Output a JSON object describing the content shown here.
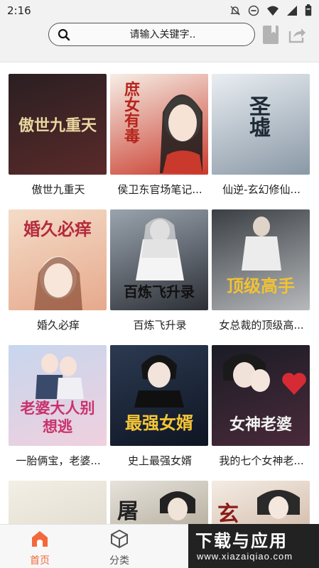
{
  "status_bar": {
    "time": "2:16"
  },
  "search": {
    "placeholder": "请输入关键字.."
  },
  "books": [
    {
      "title": "傲世九重天",
      "cover_text": "傲世九重天",
      "colors": [
        "#2a1f22",
        "#5a2a2a"
      ],
      "text_color": "#e9d5a0"
    },
    {
      "title": "侯卫东官场笔记...",
      "cover_text": "庶女有毒",
      "colors": [
        "#f6efe6",
        "#c93a2c"
      ],
      "text_color": "#b4241c"
    },
    {
      "title": "仙逆-玄幻修仙...",
      "cover_text": "圣墟",
      "colors": [
        "#e9eef2",
        "#8a98a6"
      ],
      "text_color": "#1e2a36"
    },
    {
      "title": "婚久必痒",
      "cover_text": "婚久必痒",
      "colors": [
        "#f4dcc8",
        "#e6a98c"
      ],
      "text_color": "#b42a3c"
    },
    {
      "title": "百炼飞升录",
      "cover_text": "百炼飞升录",
      "colors": [
        "#9aa4ae",
        "#2c2f36"
      ],
      "text_color": "#111111"
    },
    {
      "title": "女总裁的顶级高...",
      "cover_text": "顶级高手",
      "colors": [
        "#3a3f44",
        "#b7b9bb"
      ],
      "text_color": "#f2c233"
    },
    {
      "title": "一胎俩宝，老婆...",
      "cover_text": "老婆大人别想逃",
      "colors": [
        "#c7d6ee",
        "#f0d0de"
      ],
      "text_color": "#c8326b"
    },
    {
      "title": "史上最强女婿",
      "cover_text": "最强女婿",
      "colors": [
        "#2c3a52",
        "#0e1522"
      ],
      "text_color": "#f5c637"
    },
    {
      "title": "我的七个女神老...",
      "cover_text": "女神老婆",
      "colors": [
        "#1a1c26",
        "#4a2a3a"
      ],
      "text_color": "#f2f2f2"
    },
    {
      "title": "",
      "cover_text": "",
      "colors": [
        "#f2efe6",
        "#d9d2c2"
      ],
      "text_color": "#333333"
    },
    {
      "title": "",
      "cover_text": "屠",
      "colors": [
        "#e6e3dc",
        "#9a8f7a"
      ],
      "text_color": "#222222"
    },
    {
      "title": "",
      "cover_text": "玄",
      "colors": [
        "#f4ece4",
        "#c2a38c"
      ],
      "text_color": "#8a1c18"
    }
  ],
  "nav": {
    "home": "首页",
    "category": "分类"
  },
  "watermark": {
    "main": "下载与应用",
    "sub": "www.xiazaiqiao.com"
  },
  "colors": {
    "accent": "#f26a3c",
    "nav_inactive": "#555555"
  }
}
